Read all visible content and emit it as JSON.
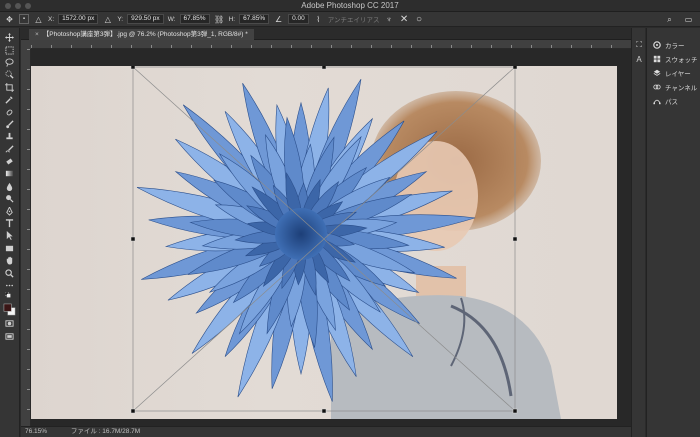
{
  "window": {
    "title": "Adobe Photoshop CC 2017"
  },
  "options_bar": {
    "x_label": "X:",
    "x_value": "1572.00 px",
    "y_label": "Y:",
    "y_value": "929.50 px",
    "w_label": "W:",
    "w_value": "67.85%",
    "h_label": "H:",
    "h_value": "67.85%",
    "angle_value": "0.00",
    "antialias_label": "アンチエイリアス",
    "cancel_icon": "close-icon",
    "commit_icon": "commit-circle-icon"
  },
  "document": {
    "tab_title": "【Photoshop講座第3弾】.jpg @ 76.2% (Photoshop第3弾_1, RGB/8#) *",
    "tab_close": "×"
  },
  "status": {
    "zoom": "76.15%",
    "file_label": "ファイル : 16.7M/28.7M"
  },
  "panels": [
    {
      "label": "カラー",
      "icon": "color-wheel-icon"
    },
    {
      "label": "スウォッチ",
      "icon": "swatches-grid-icon"
    },
    {
      "label": "レイヤー",
      "icon": "layers-icon"
    },
    {
      "label": "チャンネル",
      "icon": "channels-icon"
    },
    {
      "label": "パス",
      "icon": "paths-icon"
    }
  ],
  "colors": {
    "accent_flower": "#7aa3de",
    "background": "#2b2b2b"
  }
}
